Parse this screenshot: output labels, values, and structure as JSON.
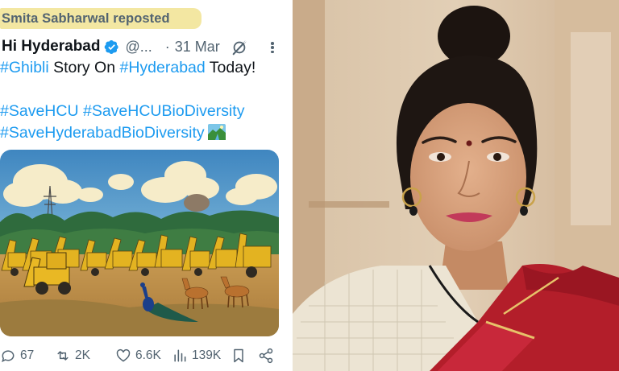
{
  "repost": {
    "text": "Smita Sabharwal reposted"
  },
  "author": {
    "name": "Hi Hyderabad",
    "handle": "@...",
    "date_separator": "·",
    "date": "31 Mar"
  },
  "tweet_text": {
    "line1_tag1": "#Ghibli",
    "line1_mid": " Story On ",
    "line1_tag2": "#Hyderabad",
    "line1_end": " Today!",
    "line2_tag1": "#SaveHCU",
    "line2_space": " ",
    "line2_tag2": "#SaveHCUBioDiversity",
    "line3_tag1": "#SaveHyderabadBioDiversity"
  },
  "actions": {
    "replies": "67",
    "reposts": "2K",
    "likes": "6.6K",
    "views": "139K"
  },
  "colors": {
    "link": "#1d9bf0",
    "text": "#0f1419",
    "muted": "#536471",
    "highlight": "#f3e7a2",
    "verified": "#1d9bf0"
  },
  "icons": [
    "verified-badge-icon",
    "grok-icon",
    "more-icon",
    "reply-icon",
    "repost-icon",
    "like-icon",
    "views-icon",
    "bookmark-icon",
    "share-icon",
    "national-park-emoji"
  ]
}
